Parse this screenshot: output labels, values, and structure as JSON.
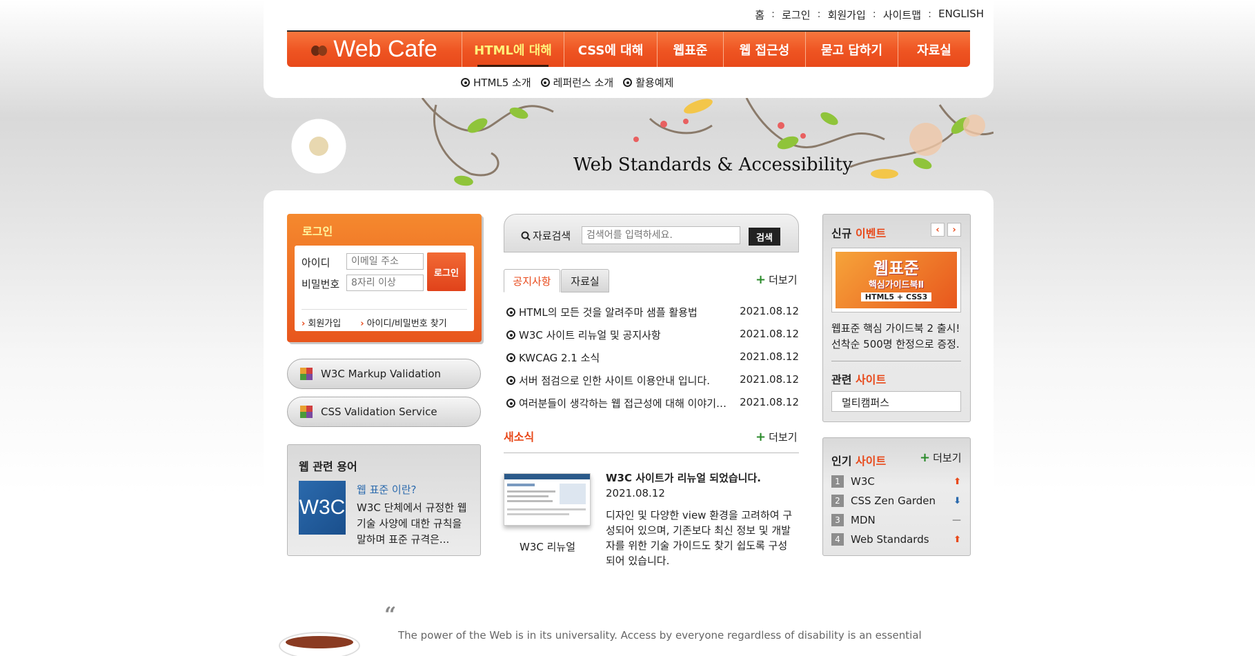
{
  "util_nav": [
    "홈",
    "로그인",
    "회원가입",
    "사이트맵",
    "ENGLISH"
  ],
  "logo": {
    "text": "Web Cafe"
  },
  "gnb": [
    "HTML에 대해",
    "CSS에 대해",
    "웹표준",
    "웹 접근성",
    "묻고 답하기",
    "자료실"
  ],
  "gnb_active": "HTML에 대해",
  "subnav": [
    "HTML5 소개",
    "레퍼런스 소개",
    "활용예제"
  ],
  "banner": {
    "title": "Web Standards & Accessibility"
  },
  "login": {
    "title": "로그인",
    "id_label": "아이디",
    "id_placeholder": "이메일 주소",
    "pw_label": "비밀번호",
    "pw_placeholder": "8자리 이상",
    "button": "로그인",
    "join_link": "회원가입",
    "find_link": "아이디/비밀번호 찾기"
  },
  "validators": [
    "W3C Markup Validation",
    "CSS Validation Service"
  ],
  "terms": {
    "title": "웹 관련 용어",
    "logo_text": "W3C",
    "question": "웹 표준 이란?",
    "answer": "W3C 단체에서 규정한 웹 기술 사양에 대한 규칙을 말하며 표준 규격은..."
  },
  "search": {
    "label": "자료검색",
    "placeholder": "검색어를 입력하세요.",
    "button": "검색"
  },
  "tabs": [
    "공지사항",
    "자료실"
  ],
  "more_label": "더보기",
  "notices": [
    {
      "title": "HTML의 모든 것을 알려주마 샘플 활용법",
      "date": "2021.08.12"
    },
    {
      "title": "W3C 사이트 리뉴얼 및 공지사항",
      "date": "2021.08.12"
    },
    {
      "title": "KWCAG 2.1 소식",
      "date": "2021.08.12"
    },
    {
      "title": "서버 점검으로 인한 사이트 이용안내 입니다.",
      "date": "2021.08.12"
    },
    {
      "title": "여러분들이 생각하는 웹 접근성에 대해 이야기…",
      "date": "2021.08.12"
    }
  ],
  "news": {
    "title": "새소식",
    "thumb_caption": "W3C 리뉴얼",
    "headline": "W3C 사이트가 리뉴얼 되었습니다.",
    "date": "2021.08.12",
    "body": "디자인 및 다양한 view 환경을 고려하여 구성되어 있으며, 기존보다 최신 정보 및 개발자를 위한 기술 가이드도 찾기 쉽도록 구성되어 있습니다."
  },
  "event": {
    "title_a": "신규",
    "title_b": "이벤트",
    "book_title": "웹표준",
    "book_subtitle": "핵심가이드북Ⅱ",
    "book_badge": "HTML5 + CSS3",
    "line1": "웹표준 핵심 가이드북 2 출시!",
    "line2": "선착순 500명 한정으로 증정."
  },
  "related": {
    "title_a": "관련",
    "title_b": "사이트",
    "selected": "멀티캠퍼스"
  },
  "popular": {
    "title_a": "인기",
    "title_b": "사이트",
    "items": [
      {
        "rank": "1",
        "name": "W3C",
        "trend": "up"
      },
      {
        "rank": "2",
        "name": "CSS Zen Garden",
        "trend": "down"
      },
      {
        "rank": "3",
        "name": "MDN",
        "trend": "same"
      },
      {
        "rank": "4",
        "name": "Web Standards",
        "trend": "up"
      }
    ]
  },
  "quote": {
    "mark": "“",
    "text": "The power of the Web is in its universality. Access by everyone regardless of disability is an essential"
  },
  "colors": {
    "accent": "#e8491a",
    "gnb_active": "#fff27a",
    "link_blue": "#2b6aad",
    "plus_green": "#2a8a2a"
  }
}
